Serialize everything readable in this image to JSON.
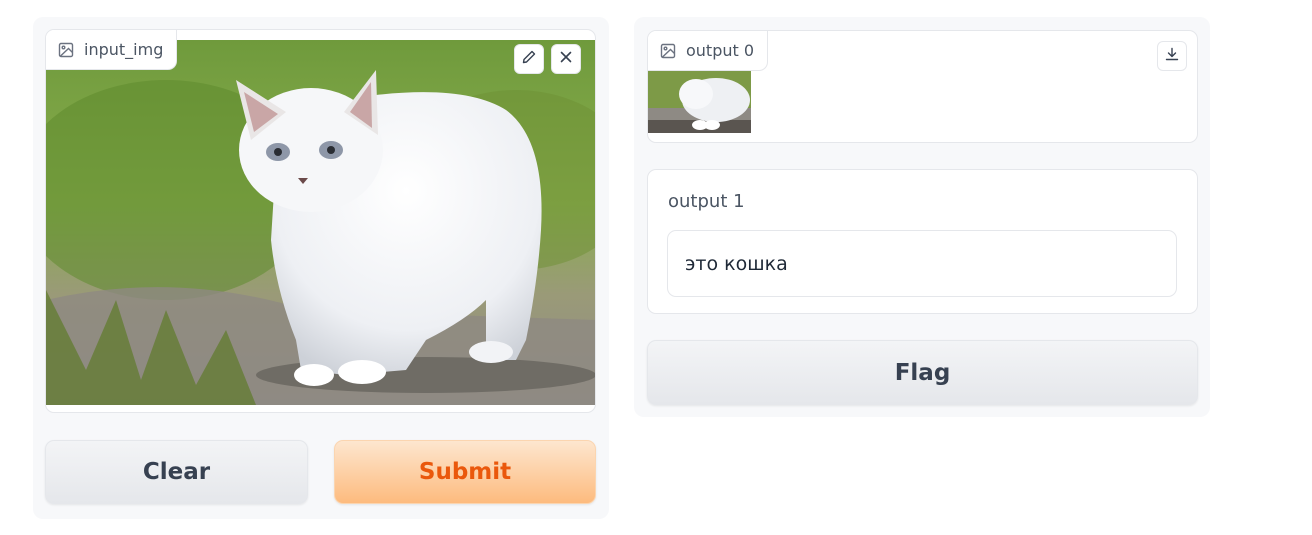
{
  "input_image": {
    "label": "input_img",
    "icons": [
      "image-icon",
      "pencil-icon",
      "close-icon"
    ]
  },
  "buttons": {
    "clear_label": "Clear",
    "submit_label": "Submit",
    "flag_label": "Flag"
  },
  "output_0": {
    "label": "output 0",
    "icons": [
      "image-icon",
      "download-icon"
    ]
  },
  "output_1": {
    "label": "output 1",
    "value": "это кошка"
  },
  "colors": {
    "primary_text": "#ea580c",
    "primary_bg": "#fdbb7e",
    "panel_bg": "#f7f8fa",
    "border": "#e5e7eb"
  }
}
